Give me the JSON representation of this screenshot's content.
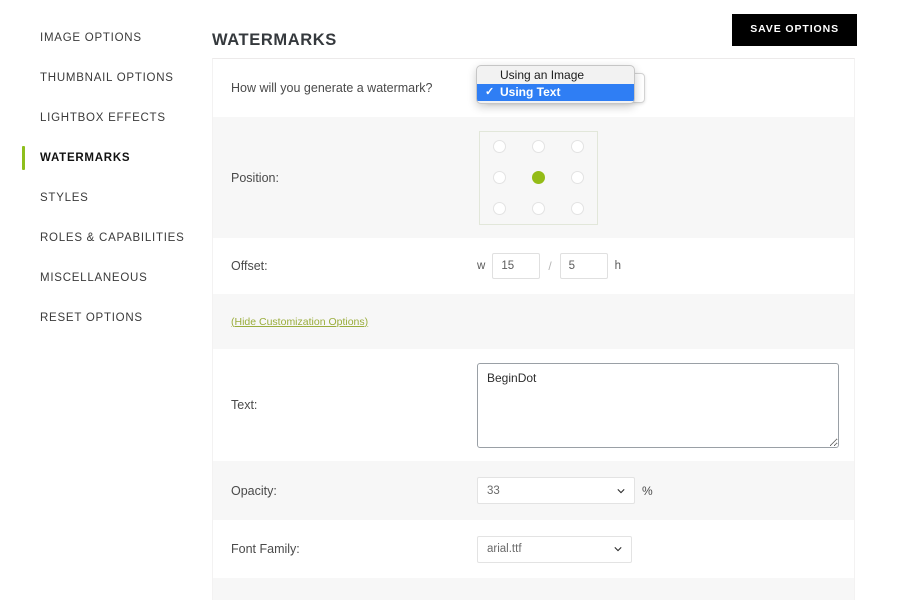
{
  "sidebar": {
    "items": [
      {
        "label": "IMAGE OPTIONS",
        "active": false
      },
      {
        "label": "THUMBNAIL OPTIONS",
        "active": false
      },
      {
        "label": "LIGHTBOX EFFECTS",
        "active": false
      },
      {
        "label": "WATERMARKS",
        "active": true
      },
      {
        "label": "STYLES",
        "active": false
      },
      {
        "label": "ROLES & CAPABILITIES",
        "active": false
      },
      {
        "label": "MISCELLANEOUS",
        "active": false
      },
      {
        "label": "RESET OPTIONS",
        "active": false
      }
    ]
  },
  "header": {
    "title": "WATERMARKS",
    "save_label": "SAVE OPTIONS"
  },
  "form": {
    "generate": {
      "label": "How will you generate a watermark?",
      "options": [
        "Using an Image",
        "Using Text"
      ],
      "selected": "Using Text",
      "checkmark": "✓"
    },
    "position": {
      "label": "Position:",
      "cells": [
        "top-left",
        "top-center",
        "top-right",
        "middle-left",
        "middle-center",
        "middle-right",
        "bottom-left",
        "bottom-center",
        "bottom-right"
      ],
      "selected_index": 4
    },
    "offset": {
      "label": "Offset:",
      "w_label": "w",
      "w_value": "15",
      "separator": "/",
      "h_value": "5",
      "h_label": "h"
    },
    "toggle": {
      "label": "(Hide Customization Options)"
    },
    "text": {
      "label": "Text:",
      "value": "BeginDot"
    },
    "opacity": {
      "label": "Opacity:",
      "value": "33",
      "unit": "%"
    },
    "font_family": {
      "label": "Font Family:",
      "value": "arial.ttf"
    }
  },
  "colors": {
    "accent_green": "#8ebf1d",
    "dot_green": "#94bc17",
    "link_green": "#9aad3c",
    "highlight_blue": "#2f7ef4",
    "button_black": "#000000"
  }
}
